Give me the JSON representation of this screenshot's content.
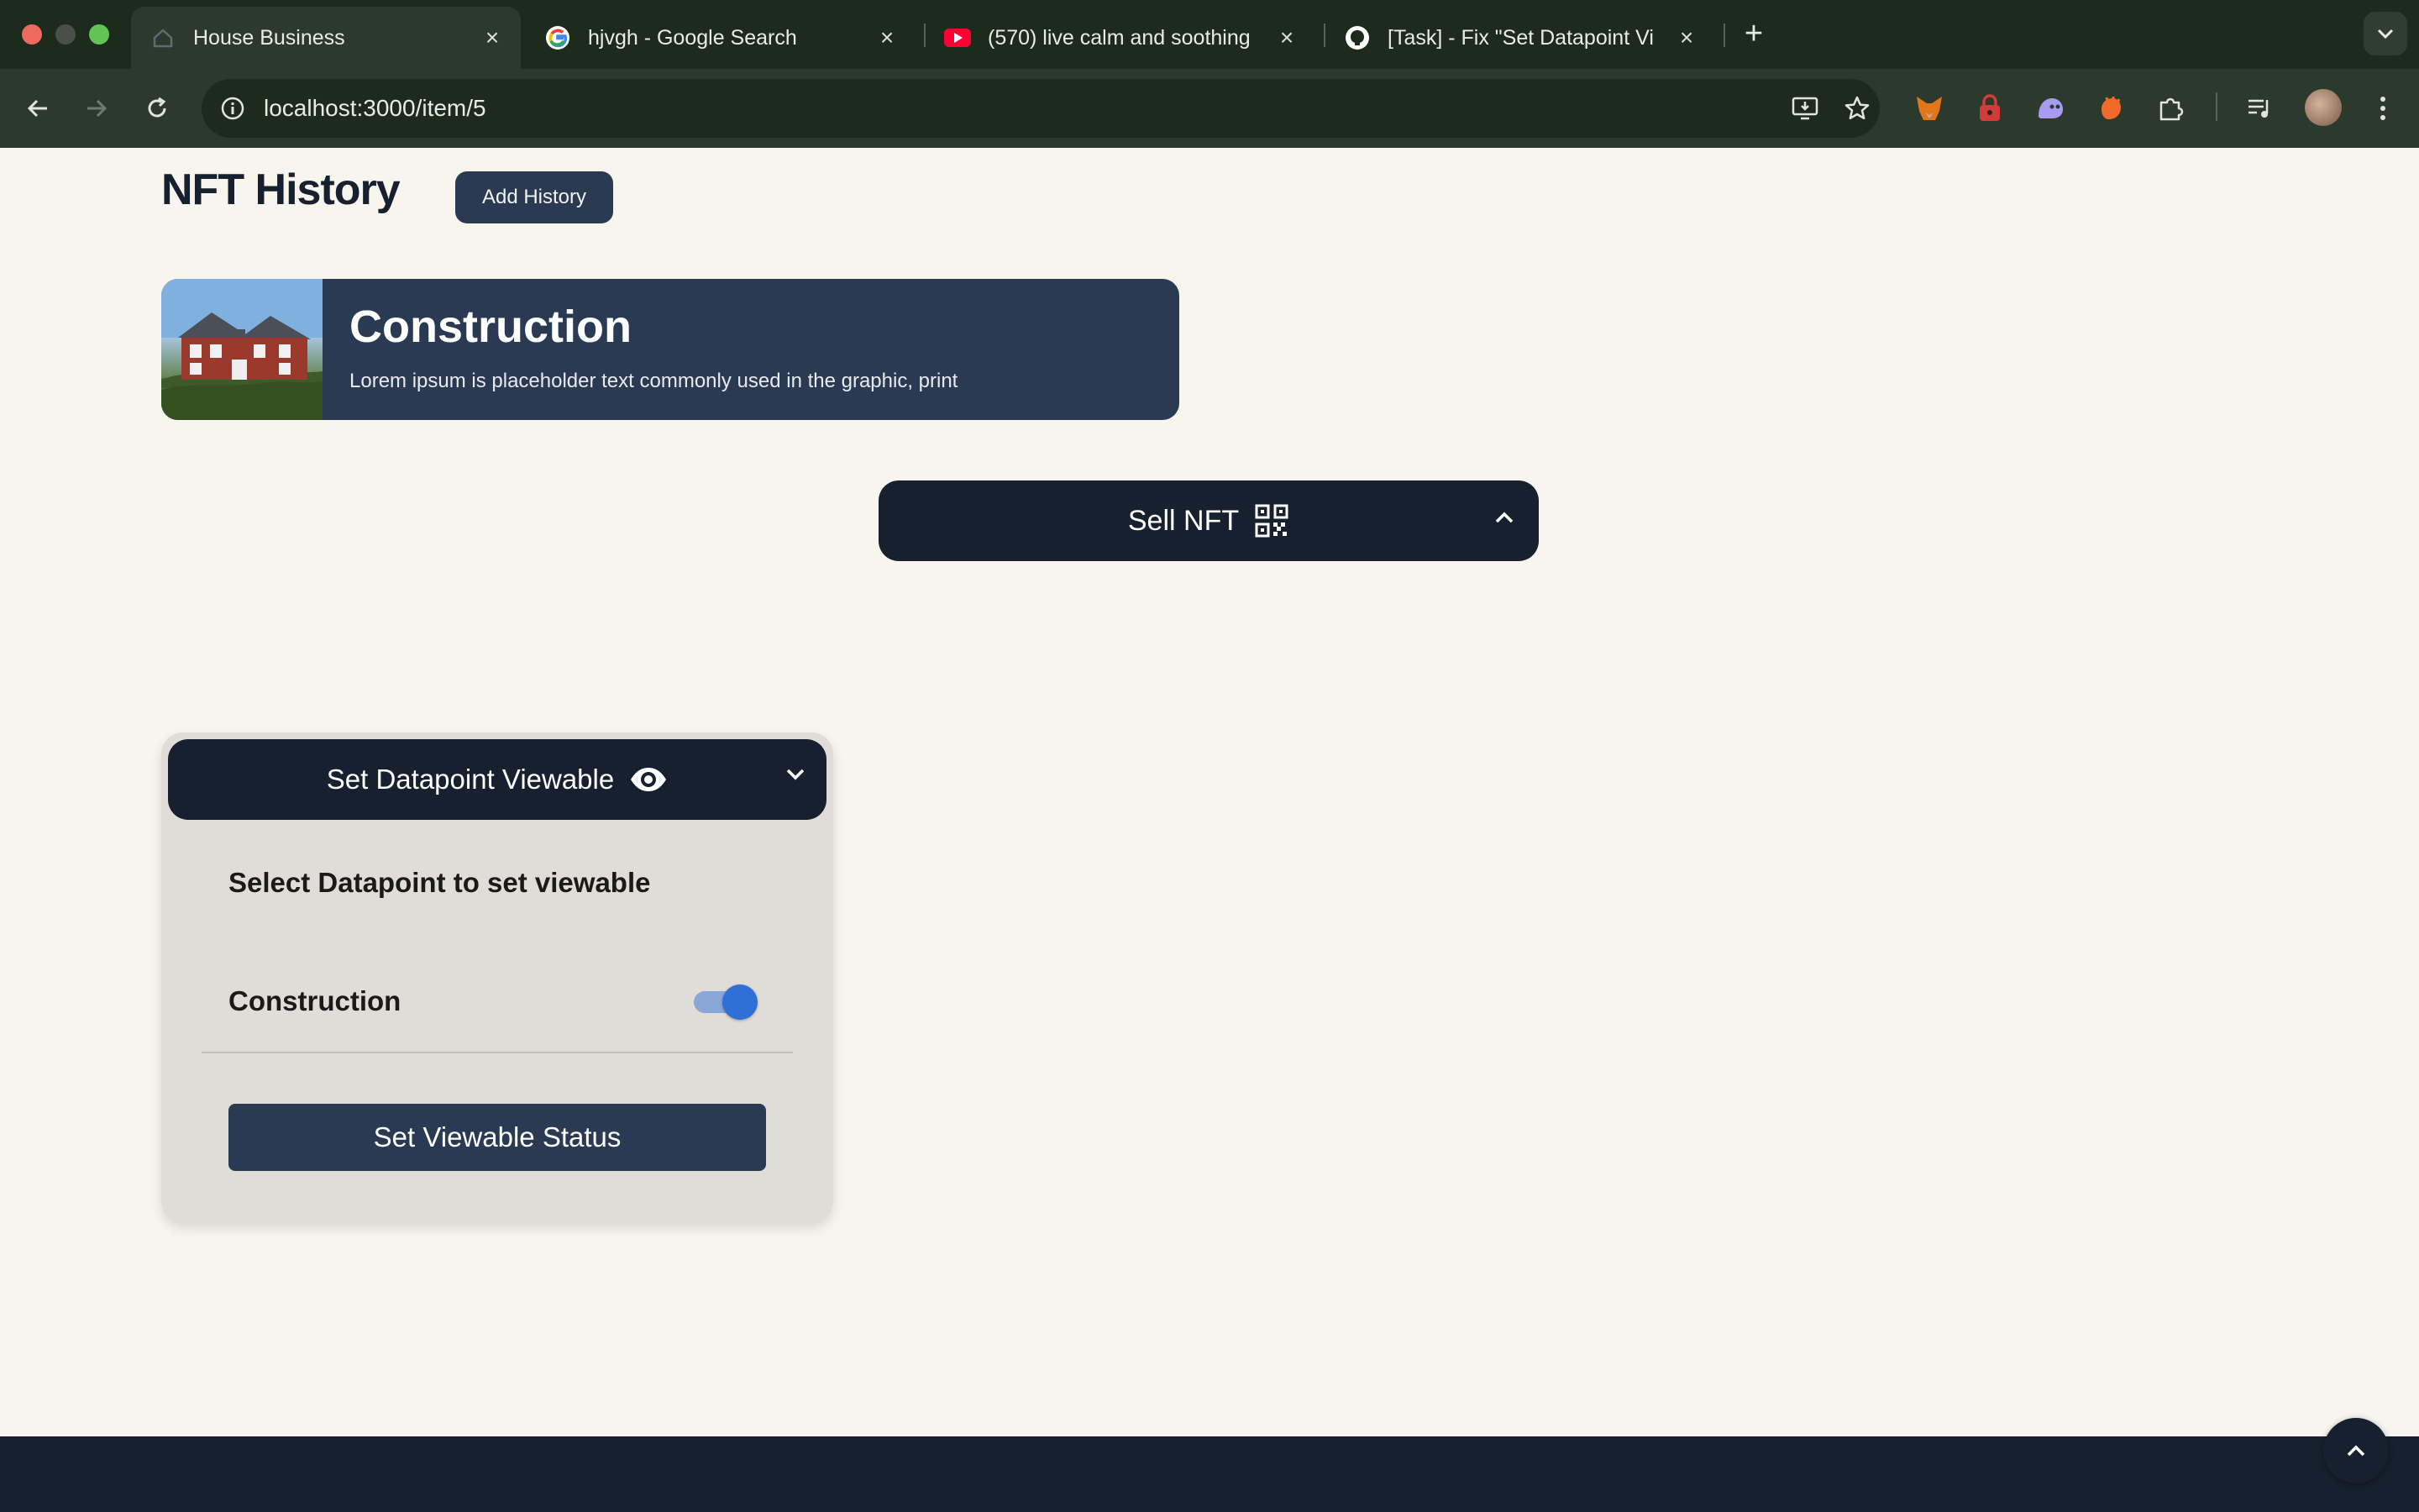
{
  "browser": {
    "tabs": [
      {
        "title": "House Business",
        "active": true
      },
      {
        "title": "hjvgh - Google Search",
        "active": false
      },
      {
        "title": "(570) live calm and soothing",
        "active": false
      },
      {
        "title": "[Task] - Fix \"Set Datapoint Vi",
        "active": false
      }
    ],
    "url": "localhost:3000/item/5"
  },
  "history": {
    "heading": "NFT History",
    "add_button": "Add History",
    "items": [
      {
        "title": "Construction",
        "description": "Lorem ipsum is placeholder text commonly used in the graphic, print"
      }
    ]
  },
  "sell": {
    "label": "Sell NFT",
    "expanded": false
  },
  "viewable": {
    "header": "Set Datapoint Viewable",
    "subtitle": "Select Datapoint to set viewable",
    "datapoints": [
      {
        "label": "Construction",
        "enabled": true
      }
    ],
    "submit_label": "Set Viewable Status"
  },
  "colors": {
    "page_bg": "#f8f4ee",
    "navy": "#16202e",
    "card_bg": "#2a3a52",
    "toggle_on": "#2f6fd6"
  }
}
